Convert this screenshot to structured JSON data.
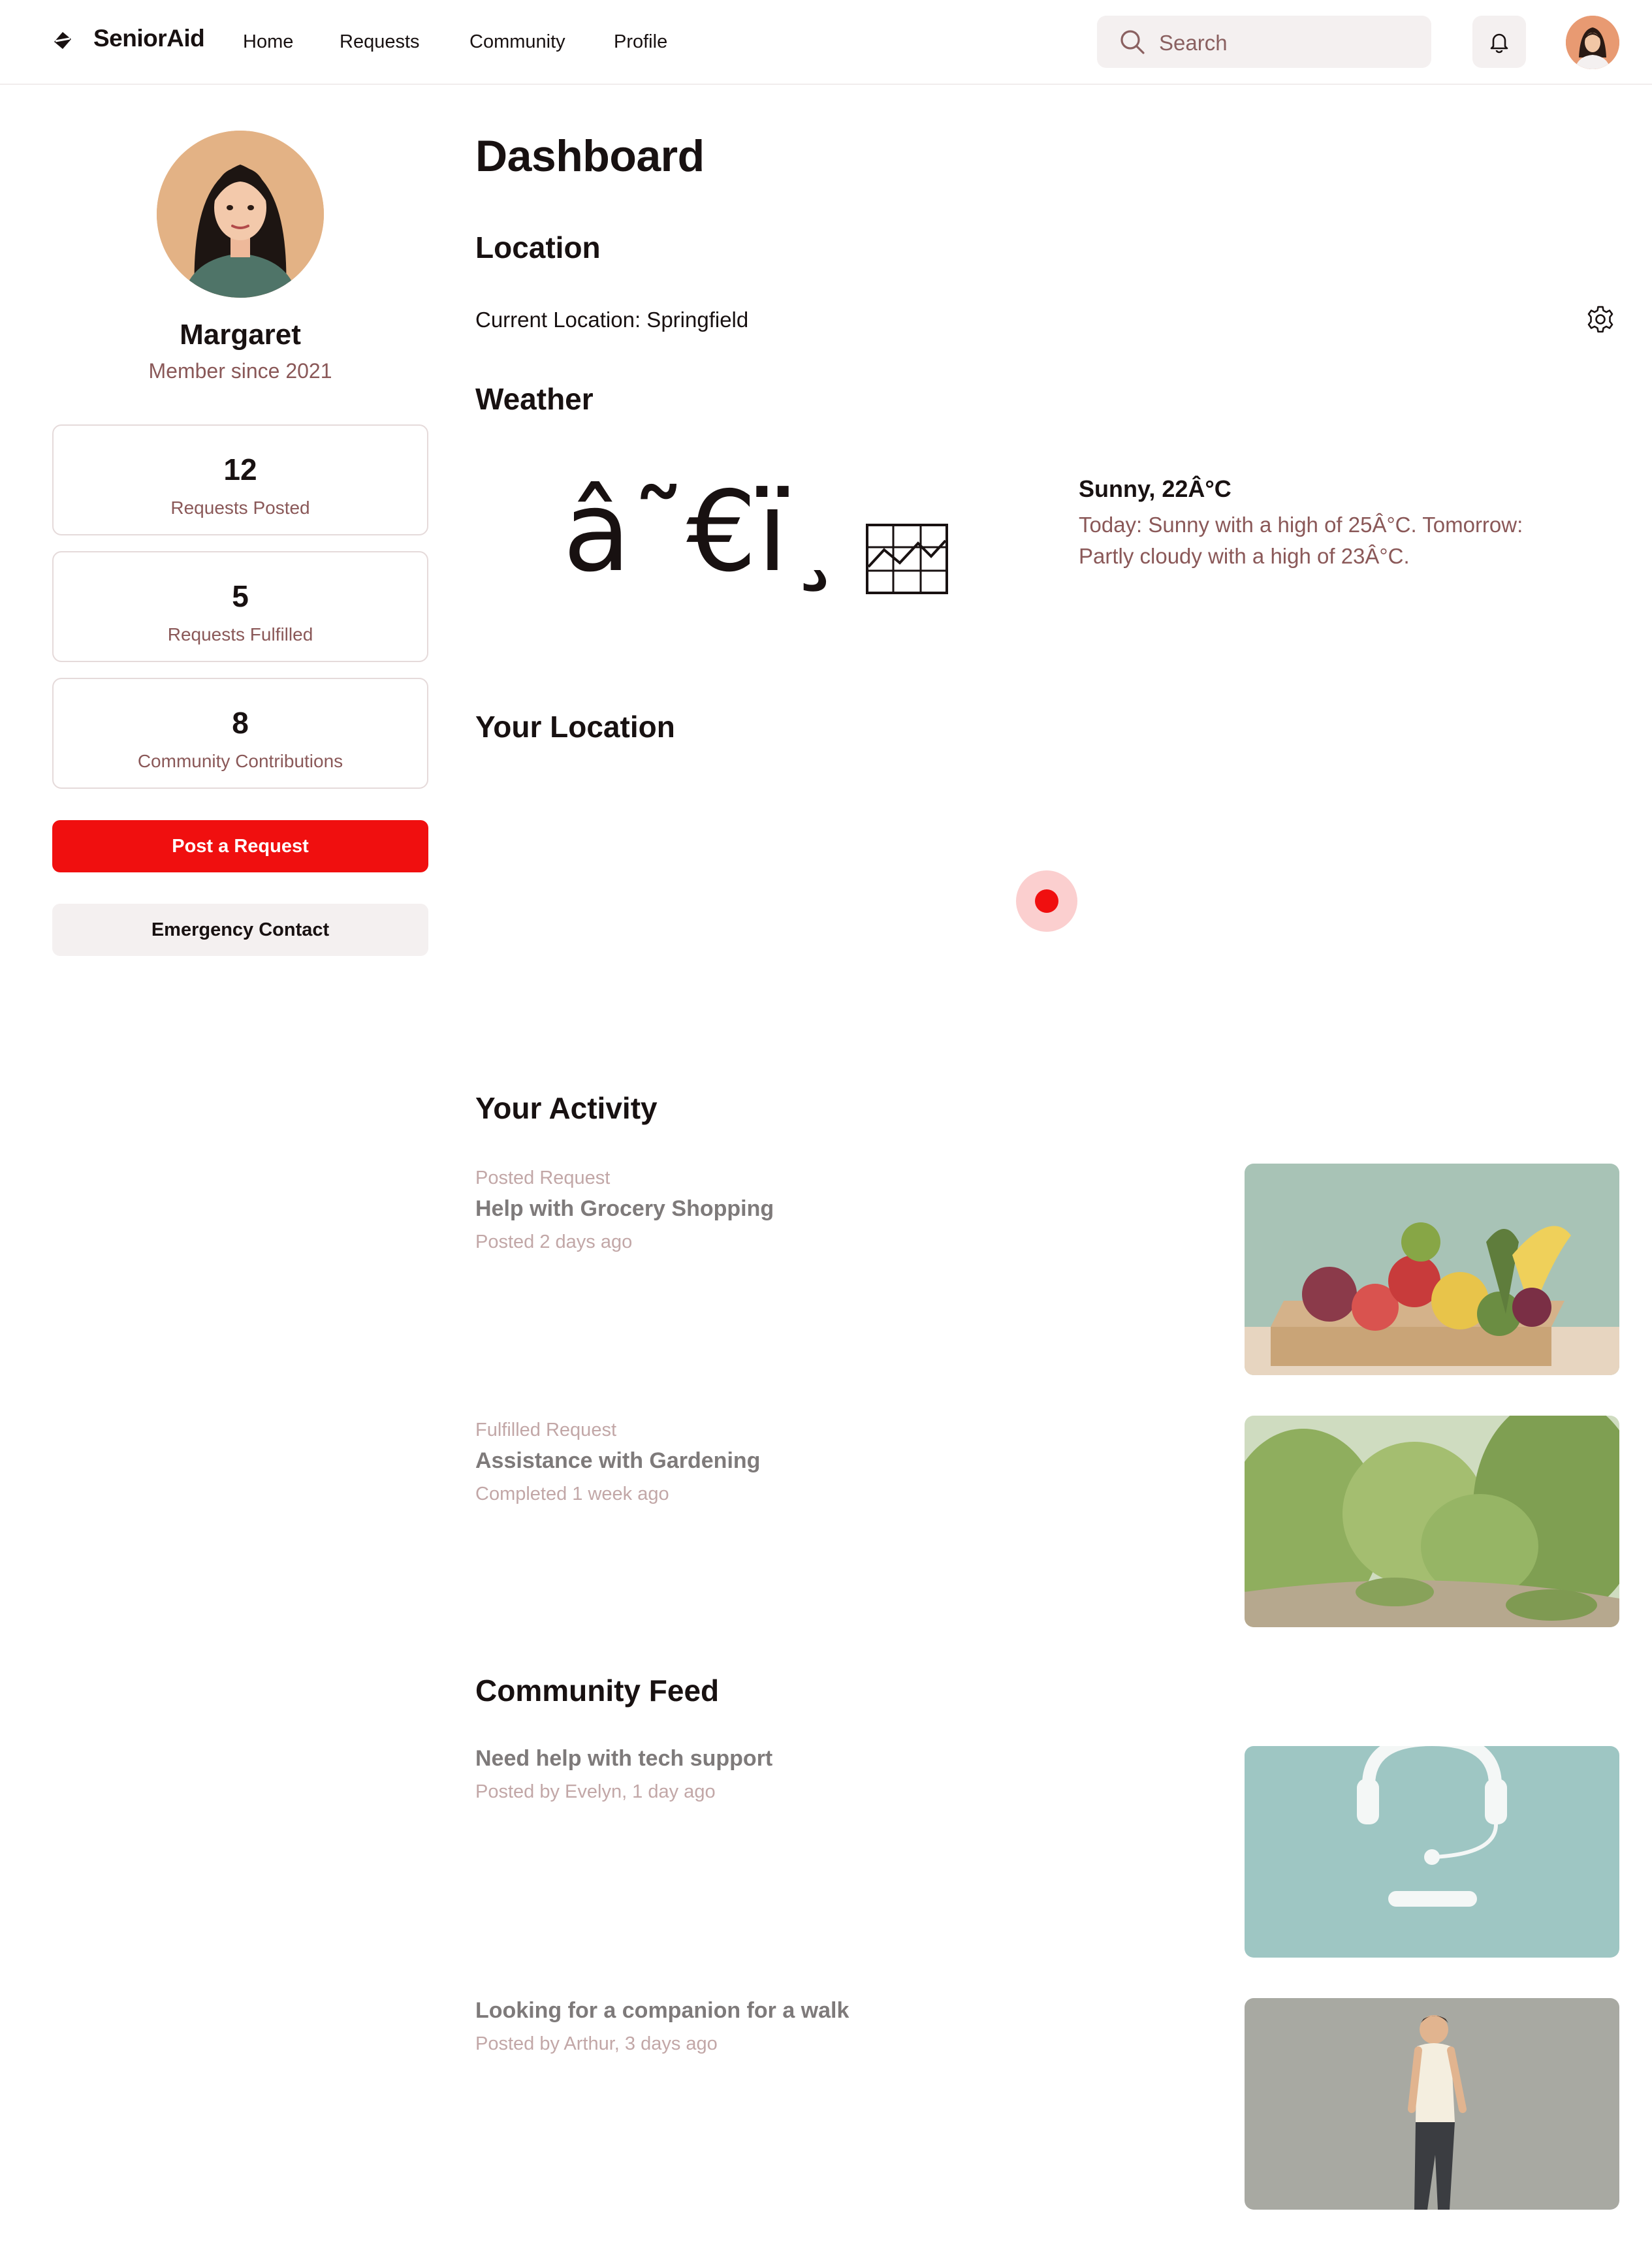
{
  "app": {
    "brand": "SeniorAid"
  },
  "nav": {
    "home": "Home",
    "requests": "Requests",
    "community": "Community",
    "profile": "Profile"
  },
  "search": {
    "placeholder": "Search"
  },
  "icons": {
    "logo": "logo-icon",
    "search": "search-icon",
    "bell": "bell-icon",
    "gear": "gear-icon",
    "chart": "chart-icon"
  },
  "profile": {
    "name": "Margaret",
    "member_since": "Member since 2021"
  },
  "stats": [
    {
      "value": "12",
      "label": "Requests Posted"
    },
    {
      "value": "5",
      "label": "Requests Fulfilled"
    },
    {
      "value": "8",
      "label": "Community Contributions"
    }
  ],
  "actions": {
    "post_request": "Post a Request",
    "emergency_contact": "Emergency Contact"
  },
  "main": {
    "title": "Dashboard",
    "location_heading": "Location",
    "current_location": "Current Location: Springfield",
    "weather_heading": "Weather",
    "weather_glyph": "â˜€ï¸",
    "weather_summary": "Sunny, 22Â°C",
    "weather_forecast": "Today: Sunny with a high of 25Â°C. Tomorrow: Partly cloudy with a high of 23Â°C.",
    "map_heading": "Your Location",
    "activity_heading": "Your Activity",
    "feed_heading": "Community Feed"
  },
  "activity": [
    {
      "type": "Posted Request",
      "title": "Help with Grocery Shopping",
      "meta": "Posted 2 days ago"
    },
    {
      "type": "Fulfilled Request",
      "title": "Assistance with Gardening",
      "meta": "Completed 1 week ago"
    }
  ],
  "feed": [
    {
      "title": "Need help with tech support",
      "meta": "Posted by Evelyn, 1 day ago"
    },
    {
      "title": "Looking for a companion for a walk",
      "meta": "Posted by Arthur, 3 days ago"
    }
  ],
  "colors": {
    "primary": "#f00f0f",
    "muted_text": "#8a5858",
    "surface": "#f4f0f0",
    "border": "#e5dada"
  }
}
